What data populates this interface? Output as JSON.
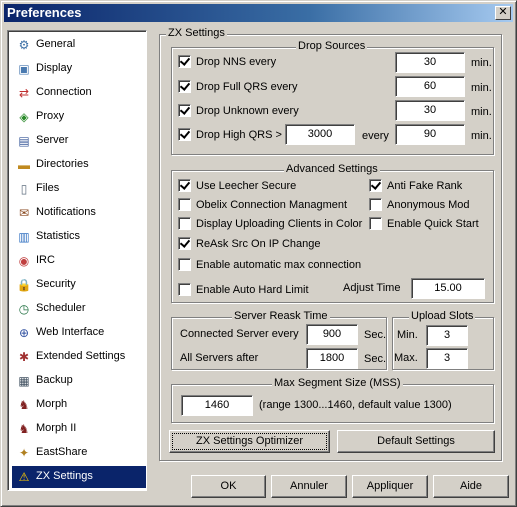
{
  "window": {
    "title": "Preferences"
  },
  "sidebar": {
    "items": [
      {
        "label": "General",
        "icon": "general-icon",
        "glyph": "⚙"
      },
      {
        "label": "Display",
        "icon": "display-icon",
        "glyph": "▣"
      },
      {
        "label": "Connection",
        "icon": "connection-icon",
        "glyph": "⇄"
      },
      {
        "label": "Proxy",
        "icon": "proxy-icon",
        "glyph": "◈"
      },
      {
        "label": "Server",
        "icon": "server-icon",
        "glyph": "▤"
      },
      {
        "label": "Directories",
        "icon": "folder-icon",
        "glyph": "▬"
      },
      {
        "label": "Files",
        "icon": "file-icon",
        "glyph": "▯"
      },
      {
        "label": "Notifications",
        "icon": "notifications-icon",
        "glyph": "✉"
      },
      {
        "label": "Statistics",
        "icon": "statistics-icon",
        "glyph": "▥"
      },
      {
        "label": "IRC",
        "icon": "irc-icon",
        "glyph": "◉"
      },
      {
        "label": "Security",
        "icon": "lock-icon",
        "glyph": "🔒"
      },
      {
        "label": "Scheduler",
        "icon": "clock-icon",
        "glyph": "◷"
      },
      {
        "label": "Web Interface",
        "icon": "globe-icon",
        "glyph": "⊕"
      },
      {
        "label": "Extended Settings",
        "icon": "extended-settings-icon",
        "glyph": "✱"
      },
      {
        "label": "Backup",
        "icon": "backup-icon",
        "glyph": "▦"
      },
      {
        "label": "Morph",
        "icon": "morph-icon",
        "glyph": "♞"
      },
      {
        "label": "Morph II",
        "icon": "morph-ii-icon",
        "glyph": "♞"
      },
      {
        "label": "EastShare",
        "icon": "eastshare-icon",
        "glyph": "✦"
      },
      {
        "label": "ZX Settings",
        "icon": "warning-icon",
        "glyph": "⚠"
      }
    ],
    "selected": "ZX Settings"
  },
  "zx": {
    "title": "ZX Settings",
    "drop_sources": {
      "title": "Drop Sources",
      "nns": {
        "label": "Drop NNS every",
        "value": "30",
        "unit": "min.",
        "checked": true
      },
      "full_qrs": {
        "label": "Drop Full QRS every",
        "value": "60",
        "unit": "min.",
        "checked": true
      },
      "unknown": {
        "label": "Drop Unknown every",
        "value": "30",
        "unit": "min.",
        "checked": true
      },
      "high_qrs": {
        "label": "Drop High QRS >",
        "threshold": "3000",
        "every_label": "every",
        "value": "90",
        "unit": "min.",
        "checked": true
      }
    },
    "advanced": {
      "title": "Advanced Settings",
      "leecher_secure": {
        "label": "Use Leecher Secure",
        "checked": true
      },
      "anti_fake_rank": {
        "label": "Anti Fake Rank",
        "checked": true
      },
      "obelix": {
        "label": "Obelix Connection Managment",
        "checked": false
      },
      "anonymous_mod": {
        "label": "Anonymous Mod",
        "checked": false
      },
      "display_uploading": {
        "label": "Display Uploading Clients in Color",
        "checked": false
      },
      "quick_start": {
        "label": "Enable Quick Start",
        "checked": false
      },
      "reask": {
        "label": "ReAsk Src On IP Change",
        "checked": true
      },
      "auto_max_conn": {
        "label": "Enable automatic max connection",
        "checked": false
      },
      "auto_hard_limit": {
        "label": "Enable Auto Hard Limit",
        "checked": false
      },
      "adjust_time_label": "Adjust Time",
      "adjust_time_value": "15.00"
    },
    "server_reask": {
      "title": "Server Reask Time",
      "connected_label": "Connected Server every",
      "connected_value": "900",
      "all_label": "All Servers after",
      "all_value": "1800",
      "unit": "Sec."
    },
    "upload_slots": {
      "title": "Upload Slots",
      "min_label": "Min.",
      "min_value": "3",
      "max_label": "Max.",
      "max_value": "3"
    },
    "mss": {
      "title": "Max Segment Size (MSS)",
      "value": "1460",
      "hint": "(range 1300...1460, default value 1300)"
    },
    "optimizer_label": "ZX Settings Optimizer",
    "default_label": "Default Settings"
  },
  "footer": {
    "ok": "OK",
    "cancel": "Annuler",
    "apply": "Appliquer",
    "help": "Aide"
  }
}
